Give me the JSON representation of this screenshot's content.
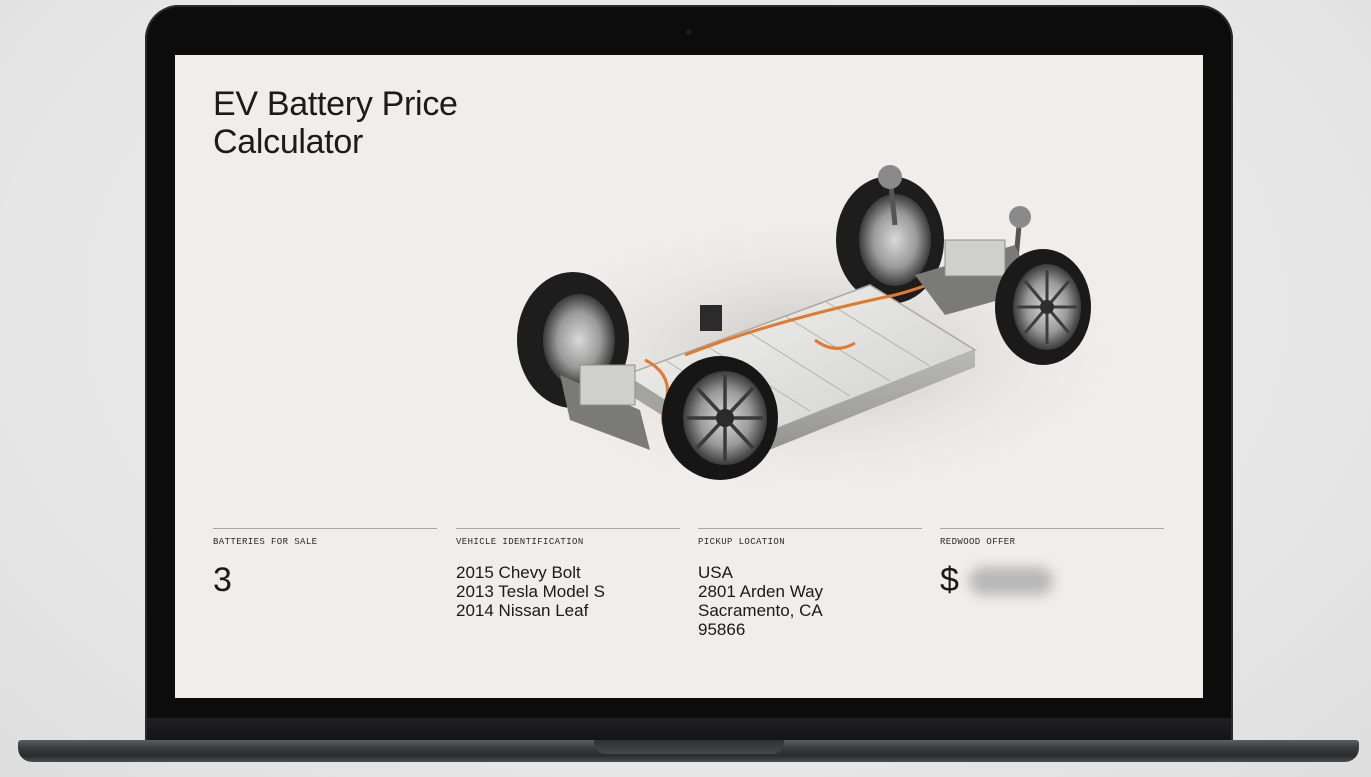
{
  "page": {
    "title_line1": "EV Battery Price",
    "title_line2": "Calculator"
  },
  "hero_image": {
    "alt": "EV chassis with battery pack"
  },
  "batteries": {
    "label": "BATTERIES FOR SALE",
    "value": "3"
  },
  "vehicles": {
    "label": "VEHICLE IDENTIFICATION",
    "items": [
      "2015 Chevy Bolt",
      "2013 Tesla Model S",
      "2014 Nissan Leaf"
    ]
  },
  "pickup": {
    "label": "PICKUP LOCATION",
    "lines": [
      "USA",
      "2801 Arden Way",
      "Sacramento, CA",
      "95866"
    ]
  },
  "offer": {
    "label": "REDWOOD OFFER",
    "currency": "$"
  },
  "colors": {
    "screen_bg": "#efeeea",
    "text": "#1b1b1b",
    "accent_cable": "#e07a2e",
    "laptop_body": "#0c0c0d"
  }
}
